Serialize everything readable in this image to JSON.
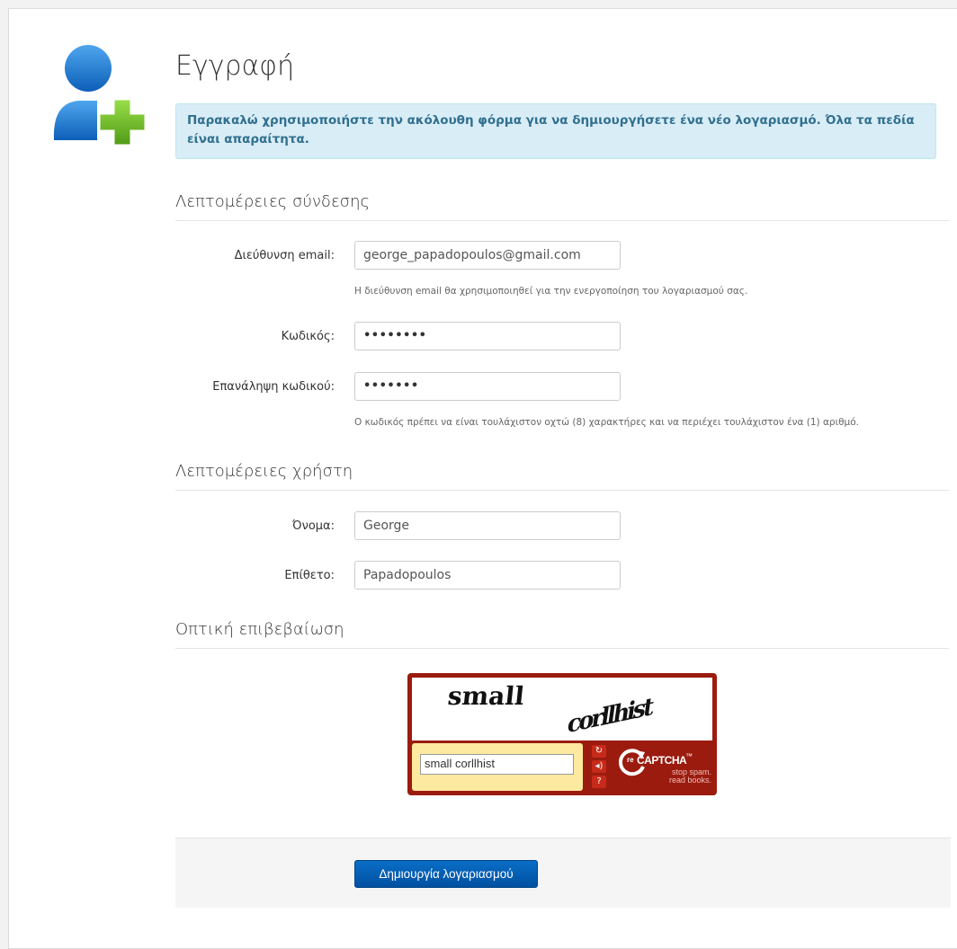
{
  "page": {
    "title": "Εγγραφή",
    "alert": "Παρακαλώ χρησιμοποιήστε την ακόλουθη φόρμα για να δημιουργήσετε ένα νέο λογαριασμό. Όλα τα πεδία είναι απαραίτητα."
  },
  "login_section": {
    "heading": "Λεπτομέρειες σύνδεσης",
    "email_label": "Διεύθυνση email:",
    "email_value": "george_papadopoulos@gmail.com",
    "email_help": "Η διεύθυνση email θα χρησιμοποιηθεί για την ενεργοποίηση του λογαριασμού σας.",
    "password_label": "Κωδικός:",
    "password_value": "••••••••",
    "confirm_label": "Επανάληψη κωδικού:",
    "confirm_value": "•••••••",
    "password_help": "Ο κωδικός πρέπει να είναι τουλάχιστον οχτώ (8) χαρακτήρες και να περιέχει τουλάχιστον ένα (1) αριθμό."
  },
  "user_section": {
    "heading": "Λεπτομέρειες χρήστη",
    "first_name_label": "Όνομα:",
    "first_name_value": "George",
    "last_name_label": "Επίθετο:",
    "last_name_value": "Papadopoulos"
  },
  "captcha_section": {
    "heading": "Οπτική επιβεβαίωση",
    "word1": "small",
    "word2": "corllhist",
    "response": "small corllhist",
    "logo_re": "re",
    "logo_text": "CAPTCHA",
    "logo_tm": "™",
    "tagline1": "stop spam.",
    "tagline2": "read books."
  },
  "footer": {
    "submit_label": "Δημιουργία λογαριασμού"
  },
  "colors": {
    "accent": "#0a6ec6",
    "alert_bg": "#d9edf7",
    "alert_text": "#31708f",
    "captcha_red": "#9b1b0f",
    "avatar_blue": "#1d7fd6",
    "plus_green": "#6fbf2a"
  }
}
